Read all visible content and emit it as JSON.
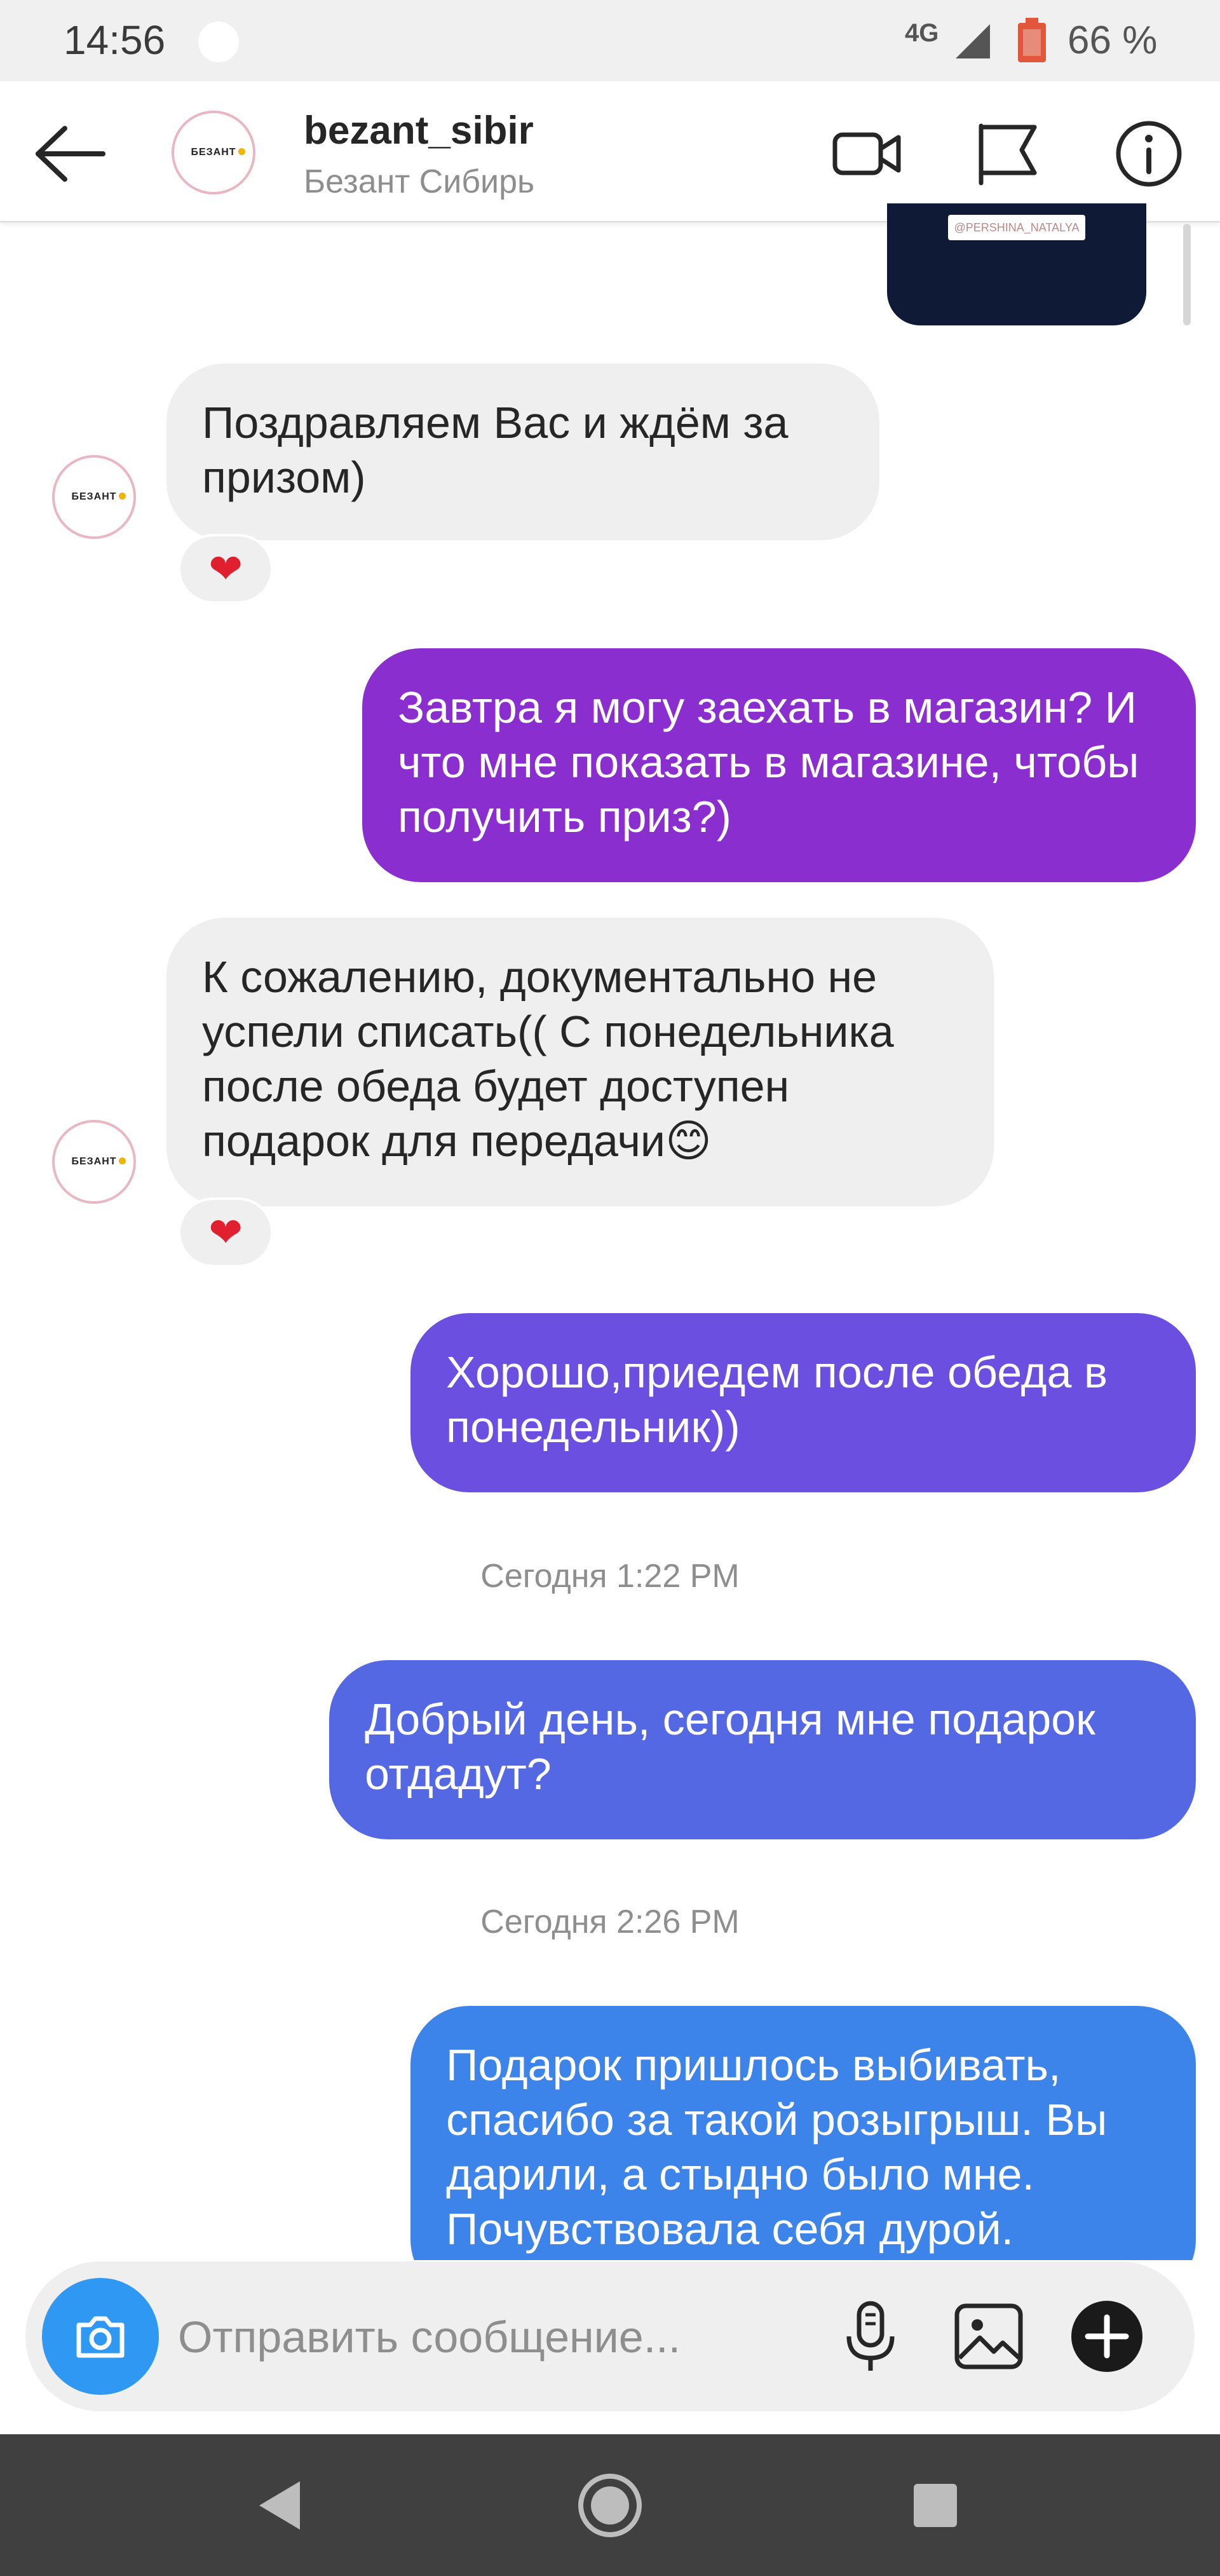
{
  "status_bar": {
    "time": "14:56",
    "network": "4G",
    "battery_percent": "66 %"
  },
  "header": {
    "username": "bezant_sibir",
    "full_name": "Безант Сибирь",
    "logo_text": "БЕЗАНТ",
    "icons": [
      "back-arrow-icon",
      "video-call-icon",
      "flag-icon",
      "info-icon"
    ]
  },
  "previous_media": {
    "caption": "@PERSHINA_NATALYA"
  },
  "messages": [
    {
      "direction": "in",
      "text": "Поздравляем Вас и ждём за призом)",
      "reaction": "❤"
    },
    {
      "direction": "out",
      "text": "Завтра я могу заехать в магазин? И что мне показать в магазине, чтобы получить приз?)"
    },
    {
      "direction": "in",
      "text": "К сожалению, документально не успели списать(( С понедельника после обеда будет доступен подарок для передачи😊",
      "reaction": "❤"
    },
    {
      "direction": "out",
      "text": "Хорошо,приедем после обеда в понедельник))"
    },
    {
      "direction": "timestamp",
      "text": "Сегодня 1:22 PM"
    },
    {
      "direction": "out",
      "text": "Добрый день, сегодня мне подарок отдадут?"
    },
    {
      "direction": "timestamp",
      "text": "Сегодня 2:26 PM"
    },
    {
      "direction": "out",
      "text": "Подарок пришлось выбивать, спасибо за такой розыгрыш. Вы дарили, а стыдно было мне. Почувствовала себя дурой."
    }
  ],
  "composer": {
    "placeholder": "Отправить сообщение...",
    "icons": [
      "camera-icon",
      "microphone-icon",
      "gallery-icon",
      "plus-icon"
    ]
  },
  "colors": {
    "bubble_out_1": "#8a2ed0",
    "bubble_out_2": "#6a4fe0",
    "bubble_out_3": "#5468e4",
    "bubble_out_4": "#3c84ea",
    "bubble_in": "#efefef",
    "camera_button": "#2f98f3"
  }
}
